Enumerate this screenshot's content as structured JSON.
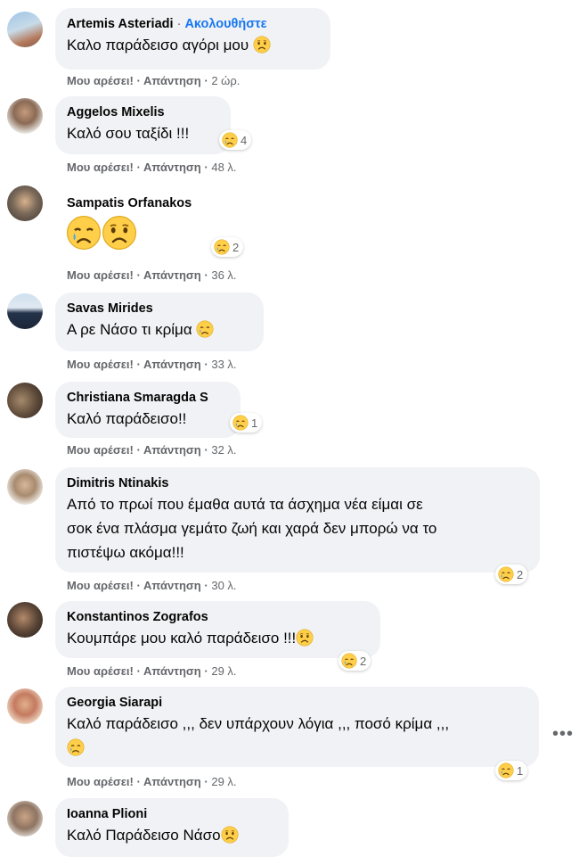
{
  "labels": {
    "like": "Μου αρέσει!",
    "reply": "Απάντηση",
    "sep": "·"
  },
  "more_label": "•••",
  "comments": [
    {
      "name": "Artemis Asteriadi",
      "follow": "Ακολουθήστε",
      "text": "Καλο παράδεισο αγόρι μου",
      "time": "2 ώρ.",
      "reaction_count": ""
    },
    {
      "name": "Aggelos Mixelis",
      "text": "Καλό σου ταξίδι !!!",
      "time": "48 λ.",
      "reaction_count": "4"
    },
    {
      "name": "Sampatis Orfanakos",
      "text": "",
      "time": "36 λ.",
      "reaction_count": "2"
    },
    {
      "name": "Savas Mirides",
      "text": "Α ρε Νάσο τι κρίμα",
      "time": "33 λ.",
      "reaction_count": ""
    },
    {
      "name": "Christiana Smaragda S",
      "text": "Καλό παράδεισο!!",
      "time": "32 λ.",
      "reaction_count": "1"
    },
    {
      "name": "Dimitris Ntinakis",
      "text_lines": [
        "Από το πρωί που έμαθα αυτά τα άσχημα νέα είμαι σε",
        "σοκ ένα πλάσμα γεμάτο ζωή και χαρά δεν μπορώ να το",
        "πιστέψω ακόμα!!!"
      ],
      "time": "30 λ.",
      "reaction_count": "2"
    },
    {
      "name": "Konstantinos Zografos",
      "text": "Κουμπάρε μου καλό παράδεισο !!!",
      "time": "29 λ.",
      "reaction_count": "2"
    },
    {
      "name": "Georgia Siarapi",
      "text": "Καλό παράδεισο ,,, δεν υπάρχουν λόγια ,,, ποσό κρίμα ,,,",
      "time": "29 λ.",
      "reaction_count": "1"
    },
    {
      "name": "Ioanna Plioni",
      "text": "Καλό Παράδεισο Νάσο",
      "time": "",
      "reaction_count": ""
    }
  ],
  "colors": {
    "bubble": "#f0f2f5",
    "link": "#1877f2",
    "meta": "#65676b",
    "emoji": "#ffcf4a"
  }
}
